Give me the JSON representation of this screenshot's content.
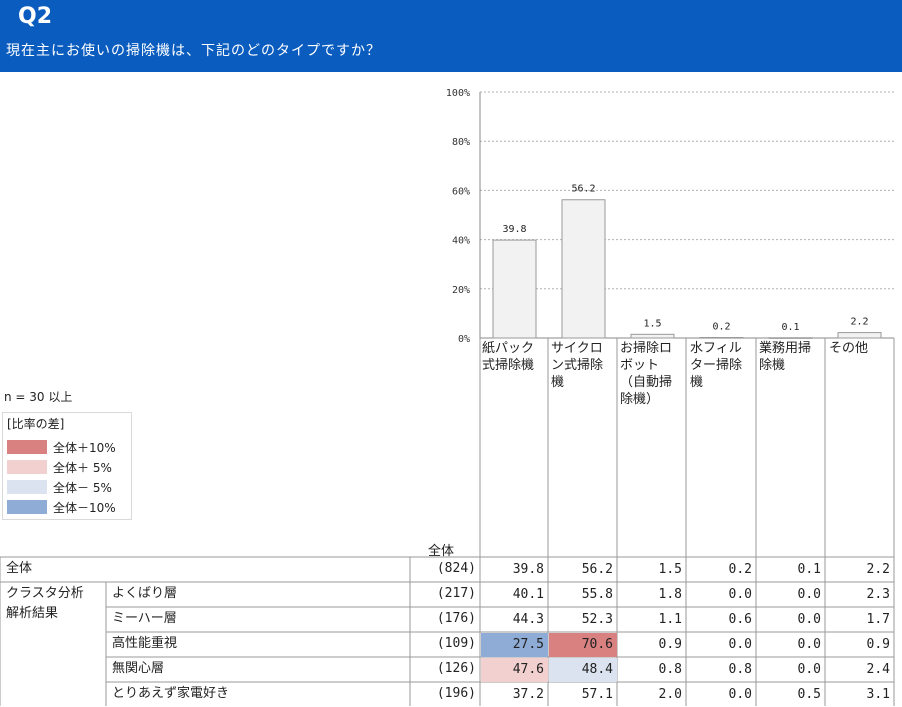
{
  "header": {
    "qnum": "Q2",
    "question": "現在主にお使いの掃除機は、下記のどのタイプですか？",
    "bg_color": "#0a5cbf"
  },
  "chart_data": {
    "type": "bar",
    "categories": [
      "紙パック式掃除機",
      "サイクロン式掃除機",
      "お掃除ロボット（自動掃除機）",
      "水フィルター掃除機",
      "業務用掃除機",
      "その他"
    ],
    "values": [
      39.8,
      56.2,
      1.5,
      0.2,
      0.1,
      2.2
    ],
    "value_labels": [
      "39.8",
      "56.2",
      "1.5",
      "0.2",
      "0.1",
      "2.2"
    ],
    "y_ticks": [
      "0%",
      "20%",
      "40%",
      "60%",
      "80%",
      "100%"
    ],
    "ylim": [
      0,
      100
    ],
    "grid": true,
    "bar_color": "#f2f2f2"
  },
  "column_headers": [
    "紙パック式掃除機",
    "サイクロン式掃除機",
    "お掃除ロボット（自動掃除機）",
    "水フィルター掃除機",
    "業務用掃除機",
    "その他"
  ],
  "note": "n = 30 以上",
  "legend": {
    "title": "[比率の差]",
    "items": [
      {
        "label": "全体＋10%",
        "color": "#d98080"
      },
      {
        "label": "全体＋ 5%",
        "color": "#f2d0d0"
      },
      {
        "label": "全体－ 5%",
        "color": "#dae3ef"
      },
      {
        "label": "全体－10%",
        "color": "#8eacd6"
      }
    ]
  },
  "table": {
    "total_head": "全体",
    "group_label_1": "クラスタ分析",
    "group_label_2": "解析結果",
    "rows": [
      {
        "label": "全体",
        "n": "(824)",
        "values": [
          "39.8",
          "56.2",
          "1.5",
          "0.2",
          "0.1",
          "2.2"
        ],
        "colors": [
          "",
          "",
          "",
          "",
          "",
          ""
        ]
      },
      {
        "label": "よくばり層",
        "n": "(217)",
        "values": [
          "40.1",
          "55.8",
          "1.8",
          "0.0",
          "0.0",
          "2.3"
        ],
        "colors": [
          "",
          "",
          "",
          "",
          "",
          ""
        ]
      },
      {
        "label": "ミーハー層",
        "n": "(176)",
        "values": [
          "44.3",
          "52.3",
          "1.1",
          "0.6",
          "0.0",
          "1.7"
        ],
        "colors": [
          "",
          "",
          "",
          "",
          "",
          ""
        ]
      },
      {
        "label": "高性能重視",
        "n": "(109)",
        "values": [
          "27.5",
          "70.6",
          "0.9",
          "0.0",
          "0.0",
          "0.9"
        ],
        "colors": [
          "#8eacd6",
          "#d98080",
          "",
          "",
          "",
          ""
        ]
      },
      {
        "label": "無関心層",
        "n": "(126)",
        "values": [
          "47.6",
          "48.4",
          "0.8",
          "0.8",
          "0.0",
          "2.4"
        ],
        "colors": [
          "#f2d0d0",
          "#dae3ef",
          "",
          "",
          "",
          ""
        ]
      },
      {
        "label": "とりあえず家電好き",
        "n": "(196)",
        "values": [
          "37.2",
          "57.1",
          "2.0",
          "0.0",
          "0.5",
          "3.1"
        ],
        "colors": [
          "",
          "",
          "",
          "",
          "",
          ""
        ]
      }
    ]
  }
}
